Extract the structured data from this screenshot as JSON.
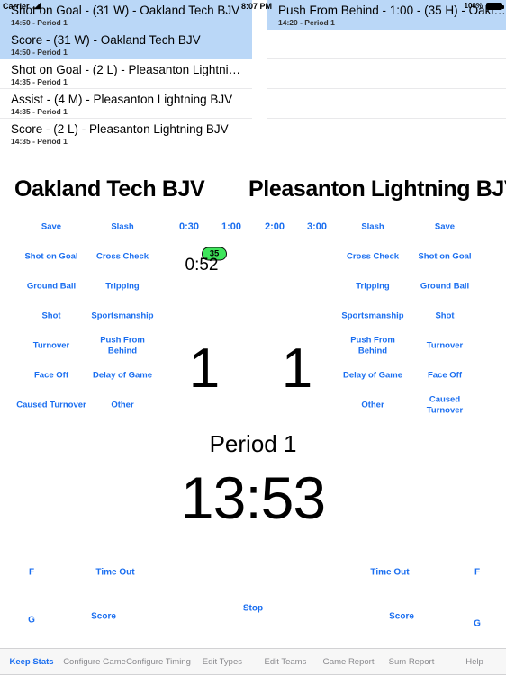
{
  "status_bar": {
    "carrier": "Carrier",
    "wifi_icon": "wifi-icon",
    "time": "8:07 PM",
    "battery_percent": "100%",
    "battery_icon": "battery-full-icon"
  },
  "event_list_left": {
    "rows": [
      {
        "title": "Shot on Goal - (31 W) - Oakland Tech BJV",
        "subtitle": "14:50 - Period 1",
        "selected": true
      },
      {
        "title": "Score - (31 W) - Oakland Tech BJV",
        "subtitle": "14:50 - Period 1",
        "selected": true
      },
      {
        "title": "Shot on Goal - (2 L) - Pleasanton Lightni…",
        "subtitle": "14:35 - Period 1",
        "selected": false
      },
      {
        "title": "Assist - (4 M) - Pleasanton Lightning BJV",
        "subtitle": "14:35 - Period 1",
        "selected": false
      },
      {
        "title": "Score - (2 L) - Pleasanton Lightning BJV",
        "subtitle": "14:35 - Period 1",
        "selected": false
      }
    ]
  },
  "event_list_right": {
    "rows": [
      {
        "title": "Push From Behind - 1:00 - (35 H) - Oakl…",
        "subtitle": "14:20 - Period 1",
        "selected": true
      },
      {
        "title": "",
        "subtitle": "",
        "selected": false
      },
      {
        "title": "",
        "subtitle": "",
        "selected": false
      },
      {
        "title": "",
        "subtitle": "",
        "selected": false
      },
      {
        "title": "",
        "subtitle": "",
        "selected": false
      }
    ]
  },
  "teams": {
    "home_name": "Oakland Tech BJV",
    "away_name": "Pleasanton Lightning BJV",
    "home_score": "1",
    "away_score": "1"
  },
  "clock": {
    "period_label": "Period 1",
    "game_time": "13:53",
    "penalty_player": "35",
    "penalty_time": "0:52"
  },
  "penalty_durations": [
    "0:30",
    "1:00",
    "2:00",
    "3:00"
  ],
  "home_stat_buttons": [
    "Save",
    "Shot on Goal",
    "Ground Ball",
    "Shot",
    "Turnover",
    "Face Off",
    "Caused Turnover"
  ],
  "home_penalty_buttons": [
    "Slash",
    "Cross Check",
    "Tripping",
    "Sportsmanship",
    "Push From\nBehind",
    "Delay of Game",
    "Other"
  ],
  "away_penalty_buttons": [
    "Slash",
    "Cross Check",
    "Tripping",
    "Sportsmanship",
    "Push From\nBehind",
    "Delay of Game",
    "Other"
  ],
  "away_stat_buttons": [
    "Save",
    "Shot on Goal",
    "Ground Ball",
    "Shot",
    "Turnover",
    "Face Off",
    "Caused Turnover"
  ],
  "controls": {
    "home_f": "F",
    "home_timeout": "Time Out",
    "away_timeout": "Time Out",
    "away_f": "F",
    "home_g": "G",
    "home_score_btn": "Score",
    "stop": "Stop",
    "away_score_btn": "Score",
    "away_g": "G"
  },
  "tabs": [
    {
      "label": "Keep Stats",
      "active": true
    },
    {
      "label": "Configure Game",
      "active": false
    },
    {
      "label": "Configure Timing",
      "active": false
    },
    {
      "label": "Edit Types",
      "active": false
    },
    {
      "label": "Edit Teams",
      "active": false
    },
    {
      "label": "Game Report",
      "active": false
    },
    {
      "label": "Sum Report",
      "active": false
    },
    {
      "label": "Help",
      "active": false
    }
  ],
  "colors": {
    "accent": "#1a6ef0",
    "selected_row": "#bad7f7",
    "penalty_badge": "#3ee55b"
  }
}
